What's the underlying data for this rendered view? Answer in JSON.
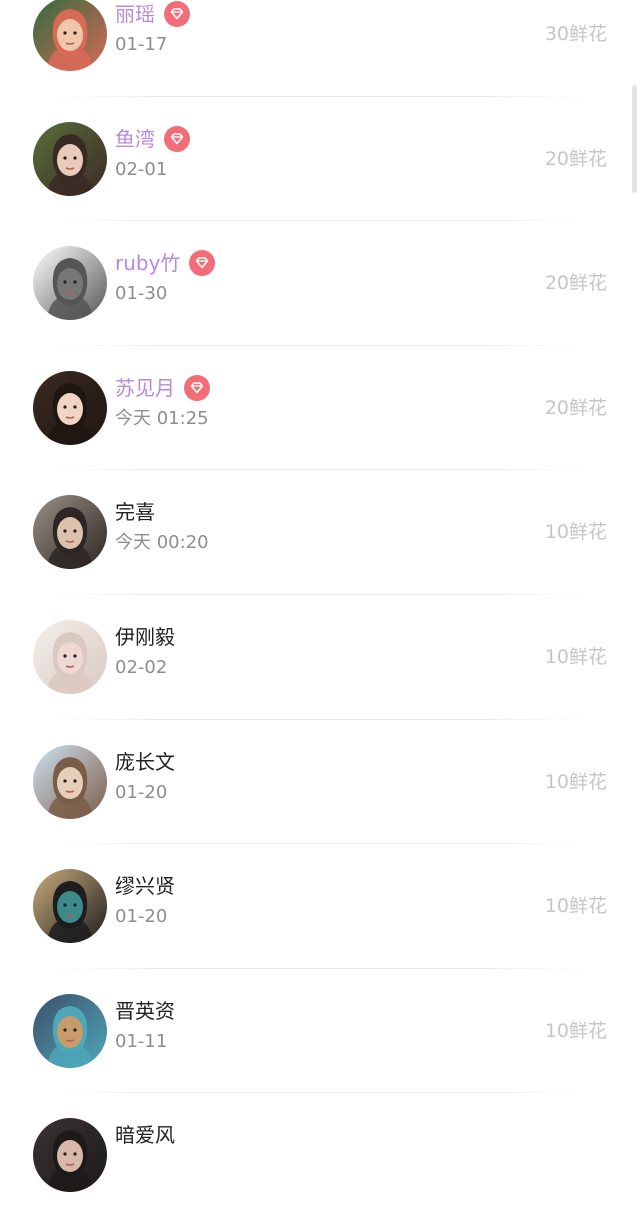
{
  "rows": [
    {
      "name": "丽瑶",
      "vip": true,
      "date": "01-17",
      "flowers": "30鲜花",
      "avatar": "photo-girl-red",
      "colors": [
        "#2f6b3c",
        "#d96a58",
        "#f0c7a8"
      ]
    },
    {
      "name": "鱼湾",
      "vip": true,
      "date": "02-01",
      "flowers": "20鲜花",
      "avatar": "photo-girl-bangs",
      "colors": [
        "#5b6f3c",
        "#3a2a24",
        "#e9cbbb"
      ]
    },
    {
      "name": "ruby竹",
      "vip": true,
      "date": "01-30",
      "flowers": "20鲜花",
      "avatar": "sketch-cat",
      "colors": [
        "#ffffff",
        "#555555",
        "#777777"
      ]
    },
    {
      "name": "苏见月",
      "vip": true,
      "date": "今天 01:25",
      "flowers": "20鲜花",
      "avatar": "photo-girl-portrait",
      "colors": [
        "#3b2a22",
        "#1f1612",
        "#f1d4c3"
      ]
    },
    {
      "name": "完喜",
      "vip": false,
      "date": "今天 00:20",
      "flowers": "10鲜花",
      "avatar": "photo-person-hand",
      "colors": [
        "#9a9086",
        "#2d2624",
        "#dcc2ad"
      ]
    },
    {
      "name": "伊刚毅",
      "vip": false,
      "date": "02-02",
      "flowers": "10鲜花",
      "avatar": "drawing-girl",
      "colors": [
        "#f4efec",
        "#d9c9c0",
        "#efd8d2"
      ]
    },
    {
      "name": "庞长文",
      "vip": false,
      "date": "01-20",
      "flowers": "10鲜花",
      "avatar": "photo-sky-girl",
      "colors": [
        "#cfe1f2",
        "#7a5d48",
        "#e6cfb9"
      ]
    },
    {
      "name": "缪兴贤",
      "vip": false,
      "date": "01-20",
      "flowers": "10鲜花",
      "avatar": "photo-sunglasses",
      "colors": [
        "#c9ac7f",
        "#1d1d1d",
        "#3c8b8a"
      ]
    },
    {
      "name": "晋英资",
      "vip": false,
      "date": "01-11",
      "flowers": "10鲜花",
      "avatar": "photo-cartoon-toy",
      "colors": [
        "#3d4f6a",
        "#4ea7b9",
        "#c79b6a"
      ]
    },
    {
      "name": "暗爱风",
      "vip": false,
      "date": "",
      "flowers": "",
      "avatar": "photo-dark",
      "colors": [
        "#3a3232",
        "#1e1a1a",
        "#d8b8a8"
      ]
    }
  ]
}
